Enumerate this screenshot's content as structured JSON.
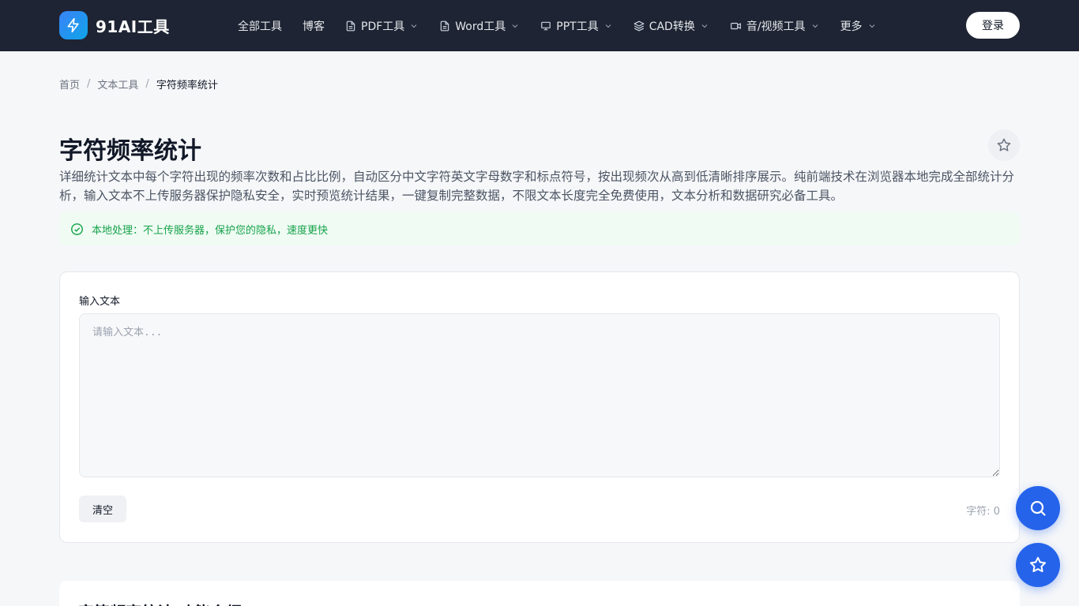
{
  "brand": {
    "name": "91AI工具",
    "accent": "#2563eb",
    "header_bg": "#1e2433"
  },
  "nav": {
    "items": [
      {
        "label": "全部工具",
        "icon": ""
      },
      {
        "label": "博客",
        "icon": ""
      },
      {
        "label": "PDF工具",
        "icon": "document-icon"
      },
      {
        "label": "Word工具",
        "icon": "document-icon"
      },
      {
        "label": "PPT工具",
        "icon": "presentation-icon"
      },
      {
        "label": "CAD转换",
        "icon": "layers-icon"
      },
      {
        "label": "音/视频工具",
        "icon": "video-icon"
      },
      {
        "label": "更多",
        "icon": ""
      }
    ],
    "login_label": "登录"
  },
  "breadcrumb": {
    "home": "首页",
    "category": "文本工具",
    "current": "字符频率统计",
    "separator": "/"
  },
  "page": {
    "title": "字符频率统计",
    "description": "详细统计文本中每个字符出现的频率次数和占比比例，自动区分中文字符英文字母数字和标点符号，按出现频次从高到低清晰排序展示。纯前端技术在浏览器本地完成全部统计分析，输入文本不上传服务器保护隐私安全，实时预览统计结果，一键复制完整数据，不限文本长度完全免费使用，文本分析和数据研究必备工具。",
    "notice": "本地处理：不上传服务器，保护您的隐私，速度更快"
  },
  "tool": {
    "input_label": "输入文本",
    "input_placeholder": "请输入文本...",
    "input_value": "",
    "clear_label": "清空",
    "char_count": "字符: 0"
  },
  "section": {
    "title": "字符频率统计 功能介绍"
  }
}
